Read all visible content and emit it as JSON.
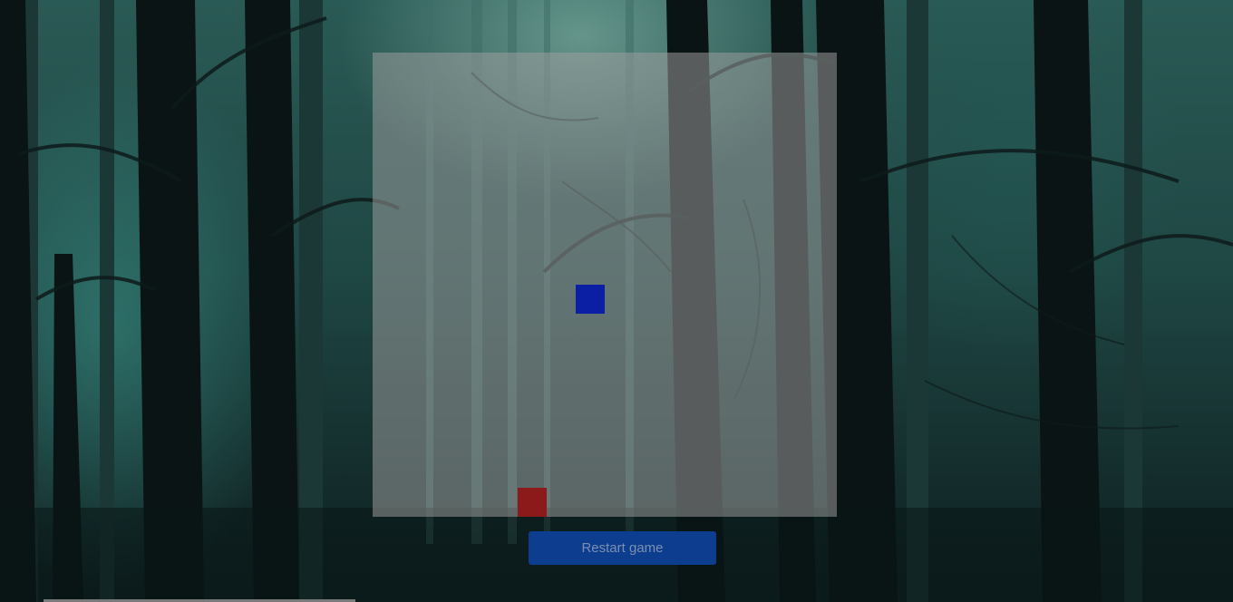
{
  "game": {
    "restart_label": "Restart game",
    "colors": {
      "board": "#a0a0a0",
      "player": "#0a1fa3",
      "food": "#8d1a1a",
      "button": "#0c3d8f"
    }
  }
}
